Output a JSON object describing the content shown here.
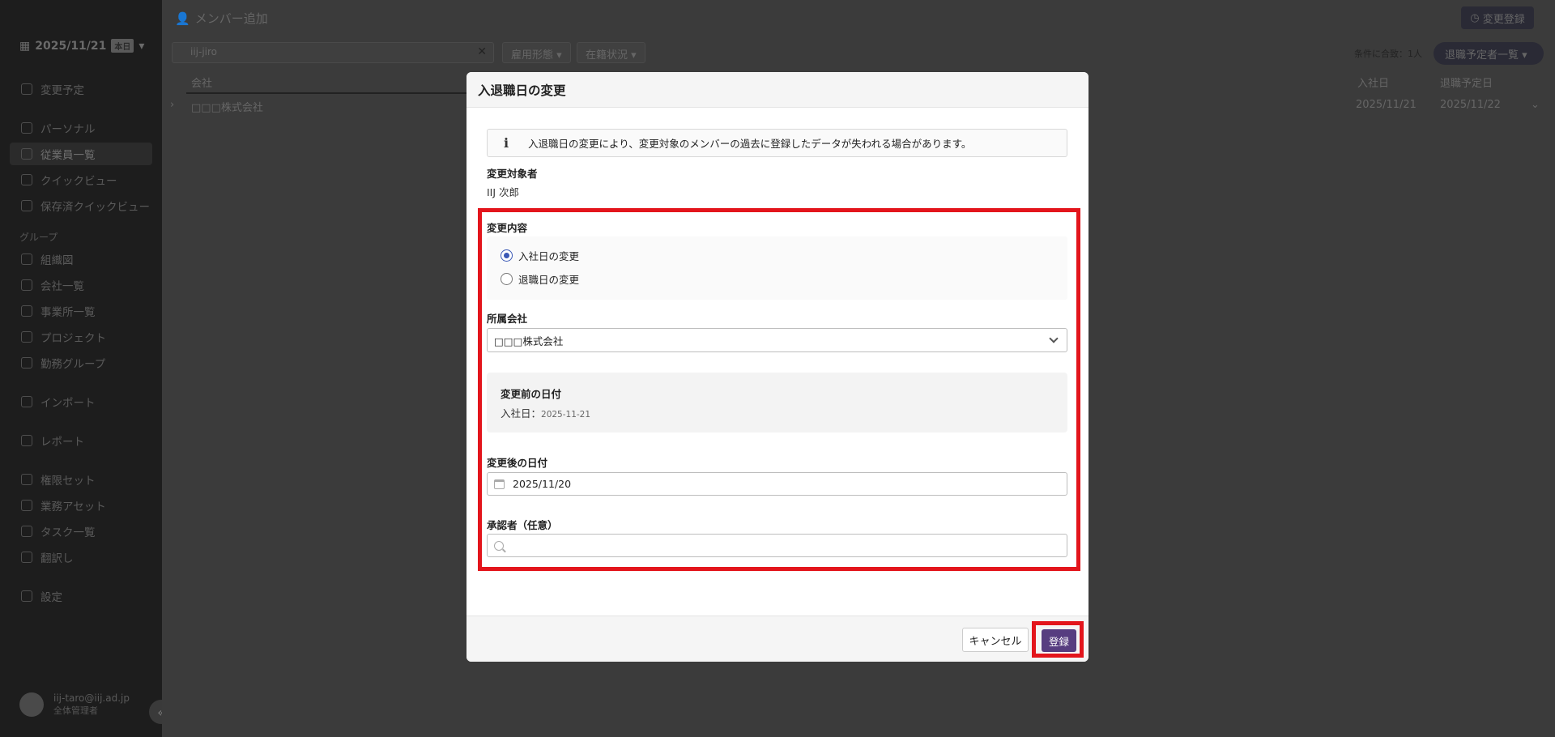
{
  "app": {
    "date_label": "2025/11/21",
    "date_badge": "本日",
    "page_title": "メンバー追加",
    "change_register_button": "変更登録",
    "search_value": "iij-jiro",
    "filters": [
      "雇用形態",
      "在籍状況"
    ],
    "count_text": "条件に合致：1人",
    "list_dropdown": "退職予定者一覧",
    "columns": {
      "company": "会社",
      "join_date": "入社日",
      "retire_date": "退職予定日"
    },
    "row": {
      "company": "□□□株式会社",
      "join_date": "2025/11/21",
      "retire_date": "2025/11/22"
    }
  },
  "sidebar": {
    "items": [
      {
        "label": "変更予定"
      },
      {
        "label": "パーソナル"
      },
      {
        "label": "従業員一覧"
      },
      {
        "label": "クイックビュー"
      },
      {
        "label": "保存済クイックビュー"
      },
      {
        "label": "組織図"
      },
      {
        "label": "会社一覧"
      },
      {
        "label": "事業所一覧"
      },
      {
        "label": "プロジェクト"
      },
      {
        "label": "勤務グループ"
      },
      {
        "label": "インポート"
      },
      {
        "label": "レポート"
      },
      {
        "label": "権限セット"
      },
      {
        "label": "業務アセット"
      },
      {
        "label": "タスク一覧"
      },
      {
        "label": "翻訳し"
      },
      {
        "label": "設定"
      }
    ],
    "group_label": "グループ",
    "user_email": "iij-taro@iij.ad.jp",
    "user_role": "全体管理者"
  },
  "modal": {
    "title": "入退職日の変更",
    "alert_text": "入退職日の変更により、変更対象のメンバーの過去に登録したデータが失われる場合があります。",
    "target_label": "変更対象者",
    "target_value": "IIJ 次郎",
    "change_type_label": "変更内容",
    "options": [
      {
        "label": "入社日の変更",
        "checked": true
      },
      {
        "label": "退職日の変更",
        "checked": false
      }
    ],
    "company_label": "所属会社",
    "company_value": "□□□株式会社",
    "before_label": "変更前の日付",
    "before_prefix": "入社日：",
    "before_value": "2025-11-21",
    "after_label": "変更後の日付",
    "after_value": "2025/11/20",
    "approver_label": "承認者（任意）",
    "approver_value": "",
    "cancel_label": "キャンセル",
    "submit_label": "登録"
  },
  "colors": {
    "accent": "#573d80",
    "highlight": "#e3151c",
    "radio": "#3a58b5"
  }
}
